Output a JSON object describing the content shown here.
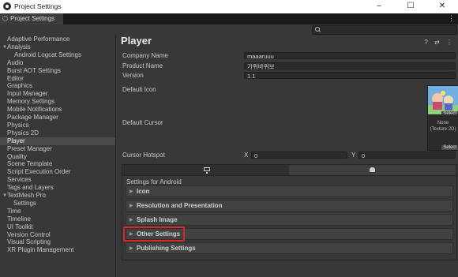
{
  "window": {
    "title": "Project Settings",
    "minimize": "–",
    "maximize": "☐",
    "close": "✕"
  },
  "tab": {
    "label": "Project Settings",
    "menu": "⋮"
  },
  "search": {
    "value": ""
  },
  "sidebar": {
    "items": [
      {
        "label": "Adaptive Performance",
        "indent": 0,
        "selected": false
      },
      {
        "label": "Analysis",
        "indent": 0,
        "arrow": "▼",
        "selected": false
      },
      {
        "label": "Android Logcat Settings",
        "indent": 2,
        "selected": false
      },
      {
        "label": "Audio",
        "indent": 0,
        "selected": false
      },
      {
        "label": "Burst AOT Settings",
        "indent": 0,
        "selected": false
      },
      {
        "label": "Editor",
        "indent": 0,
        "selected": false
      },
      {
        "label": "Graphics",
        "indent": 0,
        "selected": false
      },
      {
        "label": "Input Manager",
        "indent": 0,
        "selected": false
      },
      {
        "label": "Memory Settings",
        "indent": 0,
        "selected": false
      },
      {
        "label": "Mobile Notifications",
        "indent": 0,
        "selected": false
      },
      {
        "label": "Package Manager",
        "indent": 0,
        "selected": false
      },
      {
        "label": "Physics",
        "indent": 0,
        "selected": false
      },
      {
        "label": "Physics 2D",
        "indent": 0,
        "selected": false
      },
      {
        "label": "Player",
        "indent": 0,
        "selected": true
      },
      {
        "label": "Preset Manager",
        "indent": 0,
        "selected": false
      },
      {
        "label": "Quality",
        "indent": 0,
        "selected": false
      },
      {
        "label": "Scene Template",
        "indent": 0,
        "selected": false
      },
      {
        "label": "Script Execution Order",
        "indent": 0,
        "selected": false
      },
      {
        "label": "Services",
        "indent": 0,
        "selected": false
      },
      {
        "label": "Tags and Layers",
        "indent": 0,
        "selected": false
      },
      {
        "label": "TextMesh Pro",
        "indent": 0,
        "arrow": "▼",
        "selected": false
      },
      {
        "label": "Settings",
        "indent": 1,
        "selected": false
      },
      {
        "label": "Time",
        "indent": 0,
        "selected": false
      },
      {
        "label": "Timeline",
        "indent": 0,
        "selected": false
      },
      {
        "label": "UI Toolkit",
        "indent": 0,
        "selected": false
      },
      {
        "label": "Version Control",
        "indent": 0,
        "selected": false
      },
      {
        "label": "Visual Scripting",
        "indent": 0,
        "selected": false
      },
      {
        "label": "XR Plugin Management",
        "indent": 0,
        "selected": false
      }
    ]
  },
  "main": {
    "title": "Player",
    "header_icons": "? ⇄ ⋮",
    "company_name_label": "Company Name",
    "company_name": "maaaruuu",
    "product_name_label": "Product Name",
    "product_name": "가위바위보",
    "version_label": "Version",
    "version": "1.1",
    "default_icon_label": "Default Icon",
    "default_icon_select": "Select",
    "default_cursor_label": "Default Cursor",
    "cursor_texture_text": "None\n(Texture 2D)",
    "cursor_select": "Select",
    "cursor_hotspot_label": "Cursor Hotspot",
    "hotspot_x_label": "X",
    "hotspot_x": "0",
    "hotspot_y_label": "Y",
    "hotspot_y": "0",
    "settings_for": "Settings for Android",
    "foldouts": [
      {
        "label": "Icon",
        "highlighted": false
      },
      {
        "label": "Resolution and Presentation",
        "highlighted": false
      },
      {
        "label": "Splash Image",
        "highlighted": false
      },
      {
        "label": "Other Settings",
        "highlighted": true
      },
      {
        "label": "Publishing Settings",
        "highlighted": false
      }
    ],
    "foldout_arrow": "▶"
  },
  "colors": {
    "highlight": "#e0242c",
    "background": "#383838"
  }
}
